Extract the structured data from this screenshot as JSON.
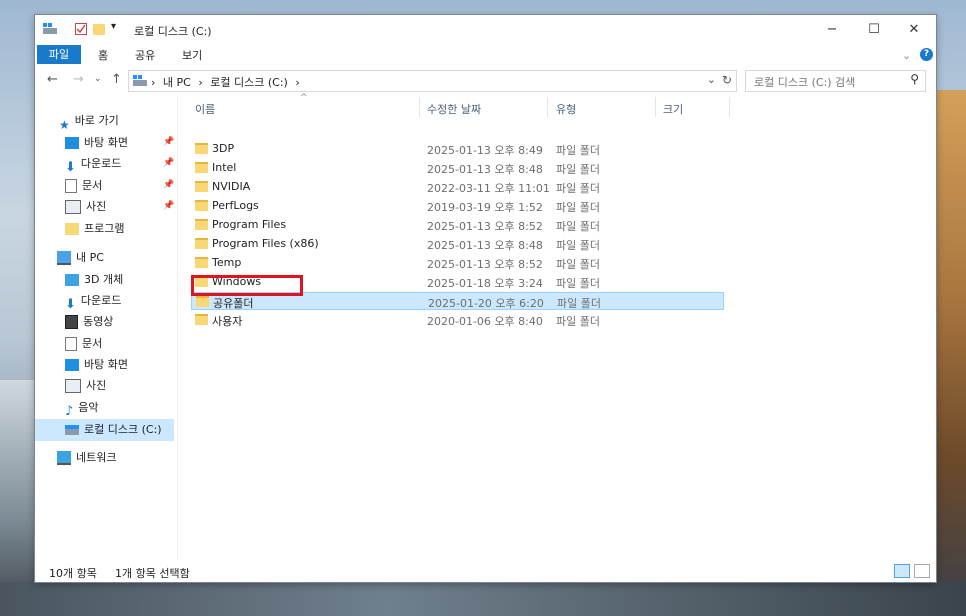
{
  "window": {
    "title": "로컬 디스크 (C:)",
    "controls": {
      "minimize": "−",
      "maximize": "☐",
      "close": "✕"
    }
  },
  "ribbon": {
    "tabs": [
      "파일",
      "홈",
      "공유",
      "보기"
    ],
    "expand": "⌄",
    "help": "?"
  },
  "address": {
    "crumbs": [
      "내 PC",
      "로컬 디스크 (C:)"
    ],
    "separator": "›",
    "search_placeholder": "로컬 디스크 (C:) 검색"
  },
  "nav": {
    "quick_access": "바로 가기",
    "quick_items": [
      "바탕 화면",
      "다운로드",
      "문서",
      "사진",
      "프로그램"
    ],
    "this_pc": "내 PC",
    "pc_items": [
      "3D 개체",
      "다운로드",
      "동영상",
      "문서",
      "바탕 화면",
      "사진",
      "음악",
      "로컬 디스크 (C:)"
    ],
    "network": "네트워크"
  },
  "columns": {
    "name": "이름",
    "modified": "수정한 날짜",
    "type": "유형",
    "size": "크기"
  },
  "files": [
    {
      "name": "3DP",
      "modified": "2025-01-13 오후 8:49",
      "type": "파일 폴더"
    },
    {
      "name": "Intel",
      "modified": "2025-01-13 오후 8:48",
      "type": "파일 폴더"
    },
    {
      "name": "NVIDIA",
      "modified": "2022-03-11 오후 11:01",
      "type": "파일 폴더"
    },
    {
      "name": "PerfLogs",
      "modified": "2019-03-19 오후 1:52",
      "type": "파일 폴더"
    },
    {
      "name": "Program Files",
      "modified": "2025-01-13 오후 8:52",
      "type": "파일 폴더"
    },
    {
      "name": "Program Files (x86)",
      "modified": "2025-01-13 오후 8:48",
      "type": "파일 폴더"
    },
    {
      "name": "Temp",
      "modified": "2025-01-13 오후 8:52",
      "type": "파일 폴더"
    },
    {
      "name": "Windows",
      "modified": "2025-01-18 오후 3:24",
      "type": "파일 폴더"
    },
    {
      "name": "공유폴더",
      "modified": "2025-01-20 오후 6:20",
      "type": "파일 폴더"
    },
    {
      "name": "사용자",
      "modified": "2020-01-06 오후 8:40",
      "type": "파일 폴더"
    }
  ],
  "status": {
    "count": "10개 항목",
    "selected": "1개 항목 선택함"
  },
  "colors": {
    "accent": "#1979ca",
    "selection": "#cce8ff",
    "highlight": "#e0141e",
    "folder": "#f8d775"
  }
}
